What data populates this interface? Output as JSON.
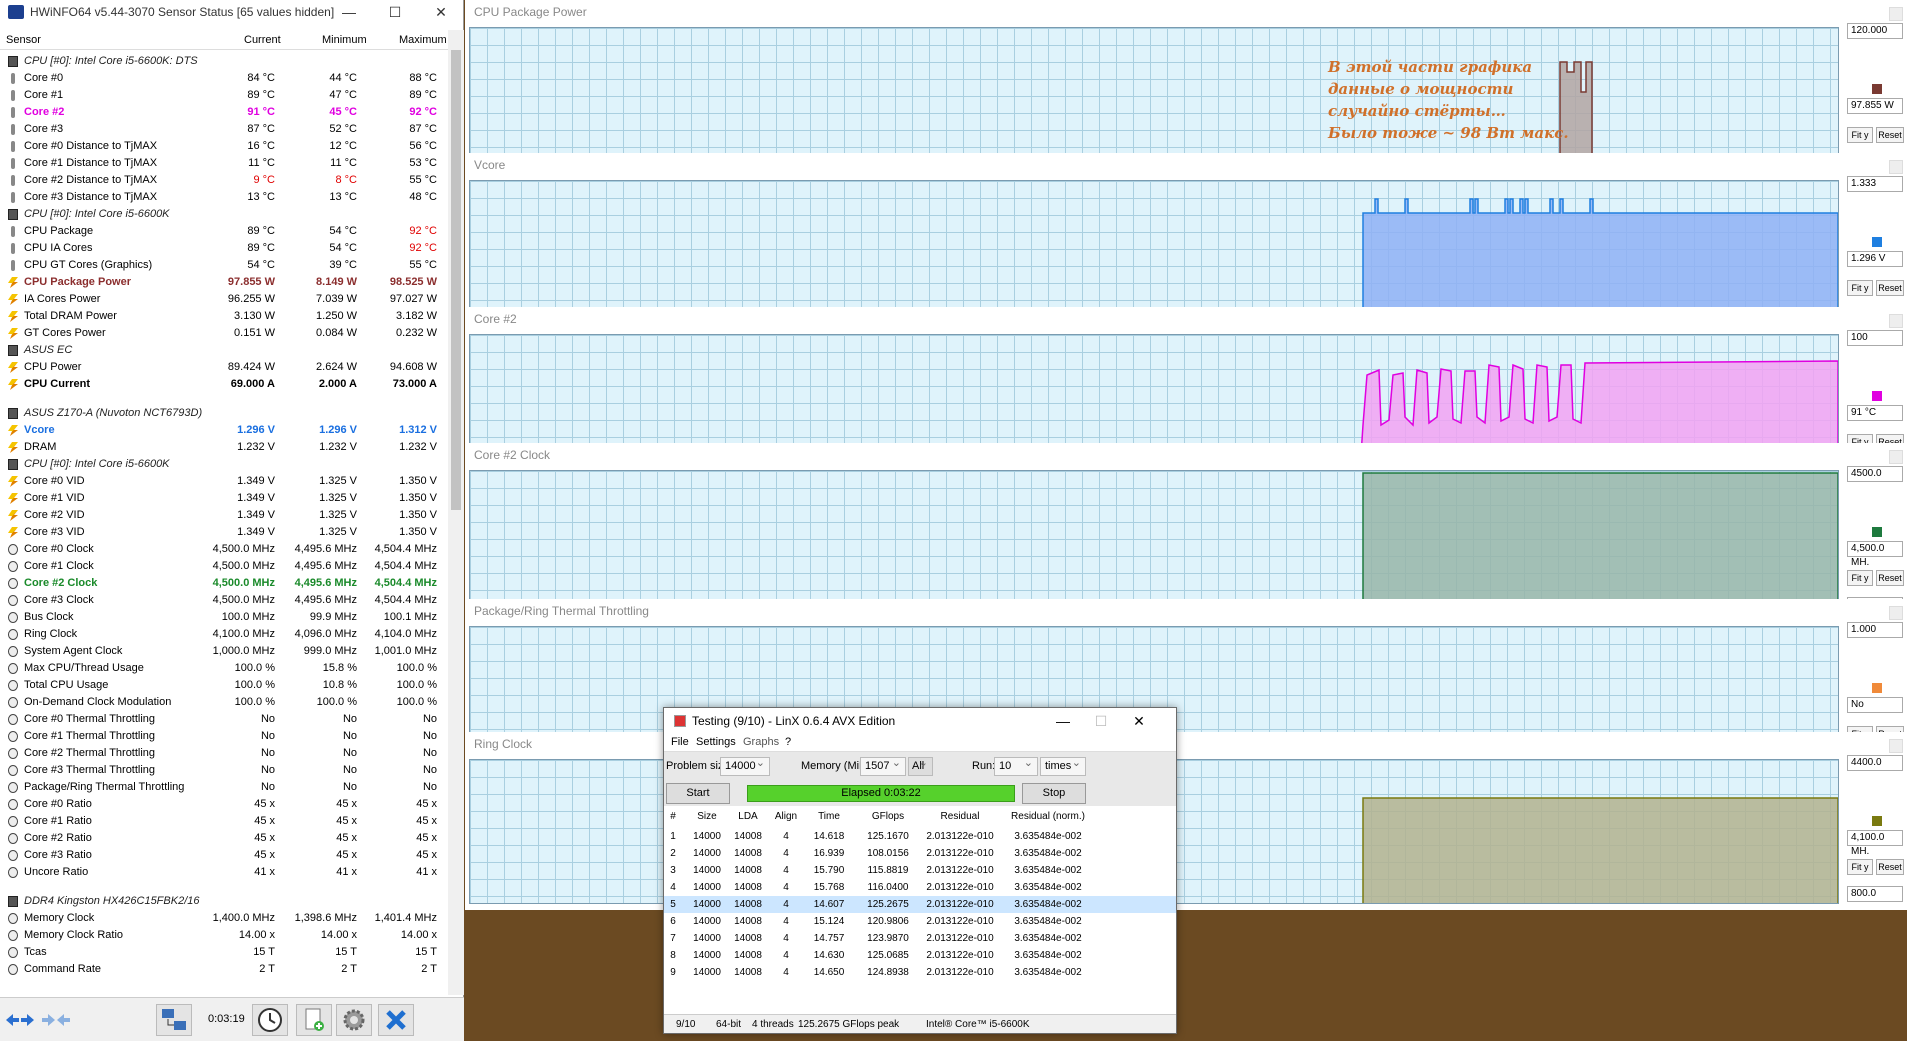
{
  "hwinfo": {
    "title": "HWiNFO64 v5.44-3070 Sensor Status [65 values hidden]",
    "columns": [
      "Sensor",
      "Current",
      "Minimum",
      "Maximum"
    ],
    "elapsed": "0:03:19",
    "rows": [
      {
        "icon": "chip",
        "name": "CPU [#0]: Intel Core i5-6600K: DTS",
        "group": true
      },
      {
        "icon": "therm",
        "name": "Core #0",
        "cur": "84 °C",
        "min": "44 °C",
        "max": "88 °C"
      },
      {
        "icon": "therm",
        "name": "Core #1",
        "cur": "89 °C",
        "min": "47 °C",
        "max": "89 °C"
      },
      {
        "icon": "therm",
        "name": "Core #2",
        "cur": "91 °C",
        "min": "45 °C",
        "max": "92 °C",
        "style": "mag"
      },
      {
        "icon": "therm",
        "name": "Core #3",
        "cur": "87 °C",
        "min": "52 °C",
        "max": "87 °C"
      },
      {
        "icon": "therm",
        "name": "Core #0 Distance to TjMAX",
        "cur": "16 °C",
        "min": "12 °C",
        "max": "56 °C"
      },
      {
        "icon": "therm",
        "name": "Core #1 Distance to TjMAX",
        "cur": "11 °C",
        "min": "11 °C",
        "max": "53 °C"
      },
      {
        "icon": "therm",
        "name": "Core #2 Distance to TjMAX",
        "cur": "9 °C",
        "min": "8 °C",
        "max": "55 °C",
        "red": [
          true,
          true,
          false
        ]
      },
      {
        "icon": "therm",
        "name": "Core #3 Distance to TjMAX",
        "cur": "13 °C",
        "min": "13 °C",
        "max": "48 °C"
      },
      {
        "icon": "chip",
        "name": "CPU [#0]: Intel Core i5-6600K",
        "group": true
      },
      {
        "icon": "therm",
        "name": "CPU Package",
        "cur": "89 °C",
        "min": "54 °C",
        "max": "92 °C",
        "red": [
          false,
          false,
          true
        ]
      },
      {
        "icon": "therm",
        "name": "CPU IA Cores",
        "cur": "89 °C",
        "min": "54 °C",
        "max": "92 °C",
        "red": [
          false,
          false,
          true
        ]
      },
      {
        "icon": "therm",
        "name": "CPU GT Cores (Graphics)",
        "cur": "54 °C",
        "min": "39 °C",
        "max": "55 °C"
      },
      {
        "icon": "bolt",
        "name": "CPU Package Power",
        "cur": "97.855 W",
        "min": "8.149 W",
        "max": "98.525 W",
        "style": "brn"
      },
      {
        "icon": "bolt",
        "name": "IA Cores Power",
        "cur": "96.255 W",
        "min": "7.039 W",
        "max": "97.027 W"
      },
      {
        "icon": "bolt",
        "name": "Total DRAM Power",
        "cur": "3.130 W",
        "min": "1.250 W",
        "max": "3.182 W"
      },
      {
        "icon": "bolt",
        "name": "GT Cores Power",
        "cur": "0.151 W",
        "min": "0.084 W",
        "max": "0.232 W"
      },
      {
        "icon": "chip",
        "name": "ASUS EC",
        "group": true
      },
      {
        "icon": "bolt",
        "name": "CPU Power",
        "cur": "89.424 W",
        "min": "2.624 W",
        "max": "94.608 W"
      },
      {
        "icon": "bolt",
        "name": "CPU Current",
        "cur": "69.000 A",
        "min": "2.000 A",
        "max": "73.000 A",
        "style": "bold"
      },
      {
        "gap": true
      },
      {
        "icon": "chip",
        "name": "ASUS Z170-A (Nuvoton NCT6793D)",
        "group": true
      },
      {
        "icon": "bolt",
        "name": "Vcore",
        "cur": "1.296 V",
        "min": "1.296 V",
        "max": "1.312 V",
        "style": "blu"
      },
      {
        "icon": "bolt",
        "name": "DRAM",
        "cur": "1.232 V",
        "min": "1.232 V",
        "max": "1.232 V"
      },
      {
        "icon": "chip",
        "name": "CPU [#0]: Intel Core i5-6600K",
        "group": true
      },
      {
        "icon": "bolt",
        "name": "Core #0 VID",
        "cur": "1.349 V",
        "min": "1.325 V",
        "max": "1.350 V"
      },
      {
        "icon": "bolt",
        "name": "Core #1 VID",
        "cur": "1.349 V",
        "min": "1.325 V",
        "max": "1.350 V"
      },
      {
        "icon": "bolt",
        "name": "Core #2 VID",
        "cur": "1.349 V",
        "min": "1.325 V",
        "max": "1.350 V"
      },
      {
        "icon": "bolt",
        "name": "Core #3 VID",
        "cur": "1.349 V",
        "min": "1.325 V",
        "max": "1.350 V"
      },
      {
        "icon": "clk",
        "name": "Core #0 Clock",
        "cur": "4,500.0 MHz",
        "min": "4,495.6 MHz",
        "max": "4,504.4 MHz"
      },
      {
        "icon": "clk",
        "name": "Core #1 Clock",
        "cur": "4,500.0 MHz",
        "min": "4,495.6 MHz",
        "max": "4,504.4 MHz"
      },
      {
        "icon": "clk",
        "name": "Core #2 Clock",
        "cur": "4,500.0 MHz",
        "min": "4,495.6 MHz",
        "max": "4,504.4 MHz",
        "style": "grn"
      },
      {
        "icon": "clk",
        "name": "Core #3 Clock",
        "cur": "4,500.0 MHz",
        "min": "4,495.6 MHz",
        "max": "4,504.4 MHz"
      },
      {
        "icon": "clk",
        "name": "Bus Clock",
        "cur": "100.0 MHz",
        "min": "99.9 MHz",
        "max": "100.1 MHz"
      },
      {
        "icon": "clk",
        "name": "Ring Clock",
        "cur": "4,100.0 MHz",
        "min": "4,096.0 MHz",
        "max": "4,104.0 MHz"
      },
      {
        "icon": "clk",
        "name": "System Agent Clock",
        "cur": "1,000.0 MHz",
        "min": "999.0 MHz",
        "max": "1,001.0 MHz"
      },
      {
        "icon": "clk",
        "name": "Max CPU/Thread Usage",
        "cur": "100.0 %",
        "min": "15.8 %",
        "max": "100.0 %"
      },
      {
        "icon": "clk",
        "name": "Total CPU Usage",
        "cur": "100.0 %",
        "min": "10.8 %",
        "max": "100.0 %"
      },
      {
        "icon": "clk",
        "name": "On-Demand Clock Modulation",
        "cur": "100.0 %",
        "min": "100.0 %",
        "max": "100.0 %"
      },
      {
        "icon": "clk",
        "name": "Core #0 Thermal Throttling",
        "cur": "No",
        "min": "No",
        "max": "No"
      },
      {
        "icon": "clk",
        "name": "Core #1 Thermal Throttling",
        "cur": "No",
        "min": "No",
        "max": "No"
      },
      {
        "icon": "clk",
        "name": "Core #2 Thermal Throttling",
        "cur": "No",
        "min": "No",
        "max": "No"
      },
      {
        "icon": "clk",
        "name": "Core #3 Thermal Throttling",
        "cur": "No",
        "min": "No",
        "max": "No"
      },
      {
        "icon": "clk",
        "name": "Package/Ring Thermal Throttling",
        "cur": "No",
        "min": "No",
        "max": "No"
      },
      {
        "icon": "clk",
        "name": "Core #0 Ratio",
        "cur": "45 x",
        "min": "45 x",
        "max": "45 x"
      },
      {
        "icon": "clk",
        "name": "Core #1 Ratio",
        "cur": "45 x",
        "min": "45 x",
        "max": "45 x"
      },
      {
        "icon": "clk",
        "name": "Core #2 Ratio",
        "cur": "45 x",
        "min": "45 x",
        "max": "45 x"
      },
      {
        "icon": "clk",
        "name": "Core #3 Ratio",
        "cur": "45 x",
        "min": "45 x",
        "max": "45 x"
      },
      {
        "icon": "clk",
        "name": "Uncore Ratio",
        "cur": "41 x",
        "min": "41 x",
        "max": "41 x"
      },
      {
        "gap": true
      },
      {
        "icon": "chip",
        "name": "DDR4 Kingston HX426C15FBK2/16",
        "group": true
      },
      {
        "icon": "clk",
        "name": "Memory Clock",
        "cur": "1,400.0 MHz",
        "min": "1,398.6 MHz",
        "max": "1,401.4 MHz"
      },
      {
        "icon": "clk",
        "name": "Memory Clock Ratio",
        "cur": "14.00 x",
        "min": "14.00 x",
        "max": "14.00 x"
      },
      {
        "icon": "clk",
        "name": "Tcas",
        "cur": "15 T",
        "min": "15 T",
        "max": "15 T"
      },
      {
        "icon": "clk",
        "name": "Command Rate",
        "cur": "2 T",
        "min": "2 T",
        "max": "2 T"
      }
    ]
  },
  "graphs": [
    {
      "title": "CPU Package Power",
      "top": "120.000",
      "cur": "97.855 W",
      "bottom": "50.000",
      "color": "#7a3a32",
      "fill": "#b3a4a2"
    },
    {
      "title": "Vcore",
      "top": "1.333",
      "cur": "1.296 V",
      "bottom": "1.193",
      "color": "#1f7fe0",
      "fill": "#8fb0f4"
    },
    {
      "title": "Core #2",
      "top": "100",
      "cur": "91 °C",
      "bottom": "40",
      "color": "#e000e0",
      "fill": "#f2a2f2"
    },
    {
      "title": "Core #2 Clock",
      "top": "4500.0",
      "cur": "4,500.0 MH.",
      "bottom": "4150.0",
      "color": "#1e7a3e",
      "fill": "#98b5a8"
    },
    {
      "title": "Package/Ring Thermal Throttling",
      "top": "1.000",
      "cur": "No",
      "bottom": "0.000",
      "color": "#f08a3a",
      "fill": "#f6c08a"
    },
    {
      "title": "Ring Clock",
      "top": "4400.0",
      "cur": "4,100.0 MH.",
      "bottom": "800.0",
      "color": "#7a7a10",
      "fill": "#b3b18e"
    }
  ],
  "graph_buttons": {
    "fit": "Fit y",
    "reset": "Reset"
  },
  "overlay_text": [
    "В этой части графика",
    "данные о мощности",
    "случайно стёрты…",
    "Было тоже ~ 98 Вт макс."
  ],
  "linx": {
    "title": "Testing (9/10) - LinX 0.6.4 AVX Edition",
    "menu": [
      "File",
      "Settings",
      "Graphs",
      "?"
    ],
    "problem_label": "Problem size:",
    "problem_value": "14000",
    "memory_label": "Memory (MiB):",
    "memory_value": "1507",
    "all_label": "All",
    "run_label": "Run:",
    "run_value": "10",
    "times_value": "times",
    "start_label": "Start",
    "stop_label": "Stop",
    "elapsed": "Elapsed 0:03:22",
    "columns": [
      "#",
      "Size",
      "LDA",
      "Align",
      "Time",
      "GFlops",
      "Residual",
      "Residual (norm.)"
    ],
    "rows": [
      [
        "1",
        "14000",
        "14008",
        "4",
        "14.618",
        "125.1670",
        "2.013122e-010",
        "3.635484e-002"
      ],
      [
        "2",
        "14000",
        "14008",
        "4",
        "16.939",
        "108.0156",
        "2.013122e-010",
        "3.635484e-002"
      ],
      [
        "3",
        "14000",
        "14008",
        "4",
        "15.790",
        "115.8819",
        "2.013122e-010",
        "3.635484e-002"
      ],
      [
        "4",
        "14000",
        "14008",
        "4",
        "15.768",
        "116.0400",
        "2.013122e-010",
        "3.635484e-002"
      ],
      [
        "5",
        "14000",
        "14008",
        "4",
        "14.607",
        "125.2675",
        "2.013122e-010",
        "3.635484e-002"
      ],
      [
        "6",
        "14000",
        "14008",
        "4",
        "15.124",
        "120.9806",
        "2.013122e-010",
        "3.635484e-002"
      ],
      [
        "7",
        "14000",
        "14008",
        "4",
        "14.757",
        "123.9870",
        "2.013122e-010",
        "3.635484e-002"
      ],
      [
        "8",
        "14000",
        "14008",
        "4",
        "14.630",
        "125.0685",
        "2.013122e-010",
        "3.635484e-002"
      ],
      [
        "9",
        "14000",
        "14008",
        "4",
        "14.650",
        "124.8938",
        "2.013122e-010",
        "3.635484e-002"
      ]
    ],
    "selected_row": 5,
    "status": [
      "9/10",
      "64-bit",
      "4 threads",
      "125.2675 GFlops peak",
      "Intel® Core™ i5-6600K"
    ]
  }
}
